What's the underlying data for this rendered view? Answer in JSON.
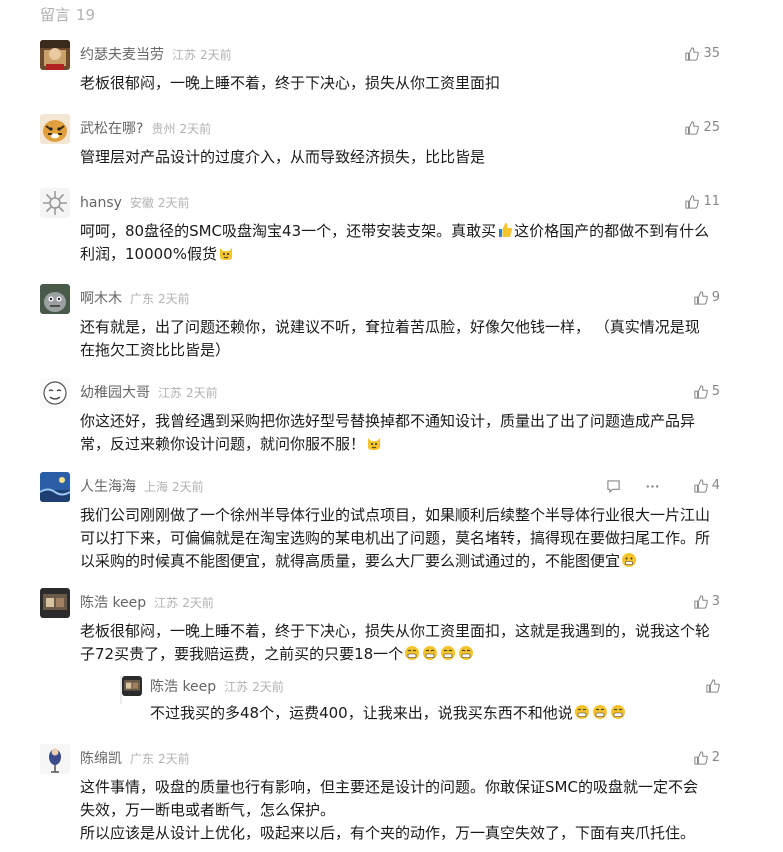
{
  "header": {
    "label": "留言",
    "count": "19"
  },
  "comments": [
    {
      "nick": "约瑟夫麦当劳",
      "loc": "江苏",
      "time": "2天前",
      "likes": "35",
      "text": "老板很郁闷，一晚上睡不着，终于下决心，损失从你工资里面扣"
    },
    {
      "nick": "武松在哪?",
      "loc": "贵州",
      "time": "2天前",
      "likes": "25",
      "text": "管理层对产品设计的过度介入，从而导致经济损失，比比皆是"
    },
    {
      "nick": "hansy",
      "loc": "安徽",
      "time": "2天前",
      "likes": "11",
      "text_a": "呵呵，80盘径的SMC吸盘淘宝43一个，还带安装支架。真敢买",
      "text_b": "这价格国产的都做不到有什么利润，10000%假货"
    },
    {
      "nick": "啊木木",
      "loc": "广东",
      "time": "2天前",
      "likes": "9",
      "text": "还有就是，出了问题还赖你，说建议不听，耷拉着苦瓜脸，好像欠他钱一样， （真实情况是现在拖欠工资比比皆是）"
    },
    {
      "nick": "幼稚园大哥",
      "loc": "江苏",
      "time": "2天前",
      "likes": "5",
      "text": "你这还好，我曾经遇到采购把你选好型号替换掉都不通知设计，质量出了出了问题造成产品异常，反过来赖你设计问题，就问你服不服！"
    },
    {
      "nick": "人生海海",
      "loc": "上海",
      "time": "2天前",
      "likes": "4",
      "text": "我们公司刚刚做了一个徐州半导体行业的试点项目，如果顺利后续整个半导体行业很大一片江山可以打下来，可偏偏就是在淘宝选购的某电机出了问题，莫名堵转，搞得现在要做扫尾工作。所以采购的时候真不能图便宜，就得高质量，要么大厂要么测试通过的，不能图便宜"
    },
    {
      "nick": "陈浩 keep",
      "loc": "江苏",
      "time": "2天前",
      "likes": "3",
      "text": "老板很郁闷，一晚上睡不着，终于下决心，损失从你工资里面扣，这就是我遇到的，说我这个轮子72买贵了，要我赔运费，之前买的只要18一个",
      "reply": {
        "nick": "陈浩 keep",
        "loc": "江苏",
        "time": "2天前",
        "text": "不过我买的多48个，运费400，让我来出，说我买东西不和他说"
      }
    },
    {
      "nick": "陈绵凯",
      "loc": "广东",
      "time": "2天前",
      "likes": "2",
      "text_lines": [
        "这件事情，吸盘的质量也行有影响，但主要还是设计的问题。你敢保证SMC的吸盘就一定不会失效，万一断电或者断气，怎么保护。",
        "所以应该是从设计上优化，吸起来以后，有个夹的动作，万一真空失效了，下面有夹爪托住。"
      ]
    }
  ]
}
